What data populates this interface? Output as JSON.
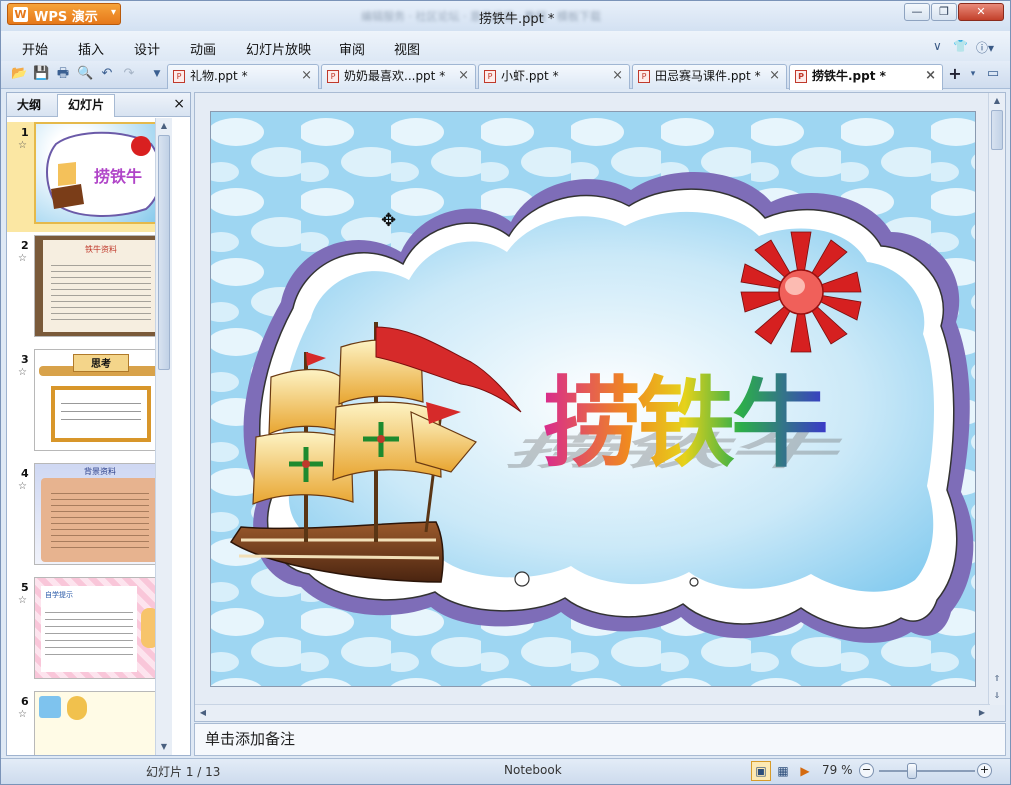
{
  "app": {
    "menu_button": "WPS 演示",
    "title": "捞铁牛.ppt *",
    "blurred_tabs": "编辑服务 · 社区论坛 · 意见反馈 · 教程 · 模板下载"
  },
  "menu": {
    "items": [
      "开始",
      "插入",
      "设计",
      "动画",
      "幻灯片放映",
      "审阅",
      "视图"
    ]
  },
  "tabs": [
    {
      "label": "礼物.ppt *",
      "active": false
    },
    {
      "label": "奶奶最喜欢...ppt *",
      "active": false
    },
    {
      "label": "小虾.ppt *",
      "active": false
    },
    {
      "label": "田忌赛马课件.ppt *",
      "active": false
    },
    {
      "label": "捞铁牛.ppt *",
      "active": true
    }
  ],
  "panel": {
    "tab_outline": "大纲",
    "tab_slides": "幻灯片",
    "close": "×"
  },
  "thumbnails": [
    {
      "num": "1",
      "star": "☆",
      "text": "捞铁牛",
      "selected": true
    },
    {
      "num": "2",
      "star": "☆",
      "text": "铁牛资料",
      "selected": false
    },
    {
      "num": "3",
      "star": "☆",
      "text": "思考",
      "selected": false
    },
    {
      "num": "4",
      "star": "☆",
      "text": "背景资料",
      "selected": false
    },
    {
      "num": "5",
      "star": "☆",
      "text": "自学提示",
      "selected": false
    },
    {
      "num": "6",
      "star": "☆",
      "text": "",
      "selected": false
    }
  ],
  "slide": {
    "title": "捞铁牛"
  },
  "notes": {
    "placeholder": "单击添加备注"
  },
  "status": {
    "slide_counter": "幻灯片 1 / 13",
    "theme": "Notebook",
    "zoom": "79 %"
  },
  "colors": {
    "accent": "#e6781a",
    "selected_thumb": "#fbe7a3"
  }
}
